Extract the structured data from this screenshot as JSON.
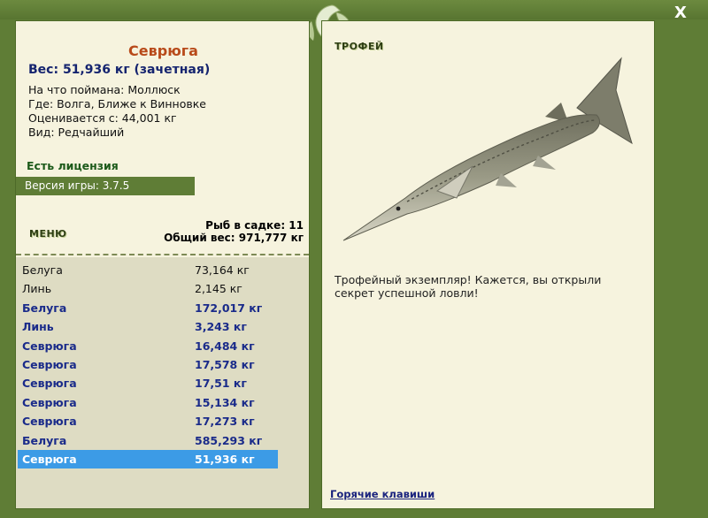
{
  "window": {
    "close_label": "X"
  },
  "fish": {
    "title": "Севрюга",
    "weight_line": "Вес: 51,936 кг (зачетная)",
    "bait_line": "На что поймана: Моллюск",
    "location_line": "Где: Волга, Ближе к Винновке",
    "valued_line": "Оценивается с: 44,001 кг",
    "type_line": "Вид: Редчайший"
  },
  "license": "Есть лицензия",
  "version": "Версия игры: 3.7.5",
  "menu_label": "МЕНЮ",
  "keepnet": {
    "count_line": "Рыб в садке: 11",
    "total_line": "Общий вес: 971,777 кг"
  },
  "catch_list": [
    {
      "name": "Белуга",
      "weight": "73,164 кг",
      "style": "normal"
    },
    {
      "name": "Линь",
      "weight": "2,145 кг",
      "style": "normal"
    },
    {
      "name": "Белуга",
      "weight": "172,017 кг",
      "style": "highlight"
    },
    {
      "name": "Линь",
      "weight": "3,243 кг",
      "style": "highlight"
    },
    {
      "name": "Севрюга",
      "weight": "16,484 кг",
      "style": "highlight"
    },
    {
      "name": "Севрюга",
      "weight": "17,578 кг",
      "style": "highlight"
    },
    {
      "name": "Севрюга",
      "weight": "17,51 кг",
      "style": "highlight"
    },
    {
      "name": "Севрюга",
      "weight": "15,134 кг",
      "style": "highlight"
    },
    {
      "name": "Севрюга",
      "weight": "17,273 кг",
      "style": "highlight"
    },
    {
      "name": "Белуга",
      "weight": "585,293 кг",
      "style": "highlight"
    },
    {
      "name": "Севрюга",
      "weight": "51,936 кг",
      "style": "selected"
    }
  ],
  "trophy": {
    "label": "ТРОФЕЙ",
    "text": "Трофейный экземпляр! Кажется, вы открыли секрет успешной ловли!"
  },
  "hotkeys_label": "Горячие клавиши",
  "colors": {
    "frame": "#5f7d36",
    "panel": "#f6f3de",
    "title": "#b84a1a",
    "highlight_text": "#1a2b8a",
    "selected_row": "#3c9be6"
  }
}
